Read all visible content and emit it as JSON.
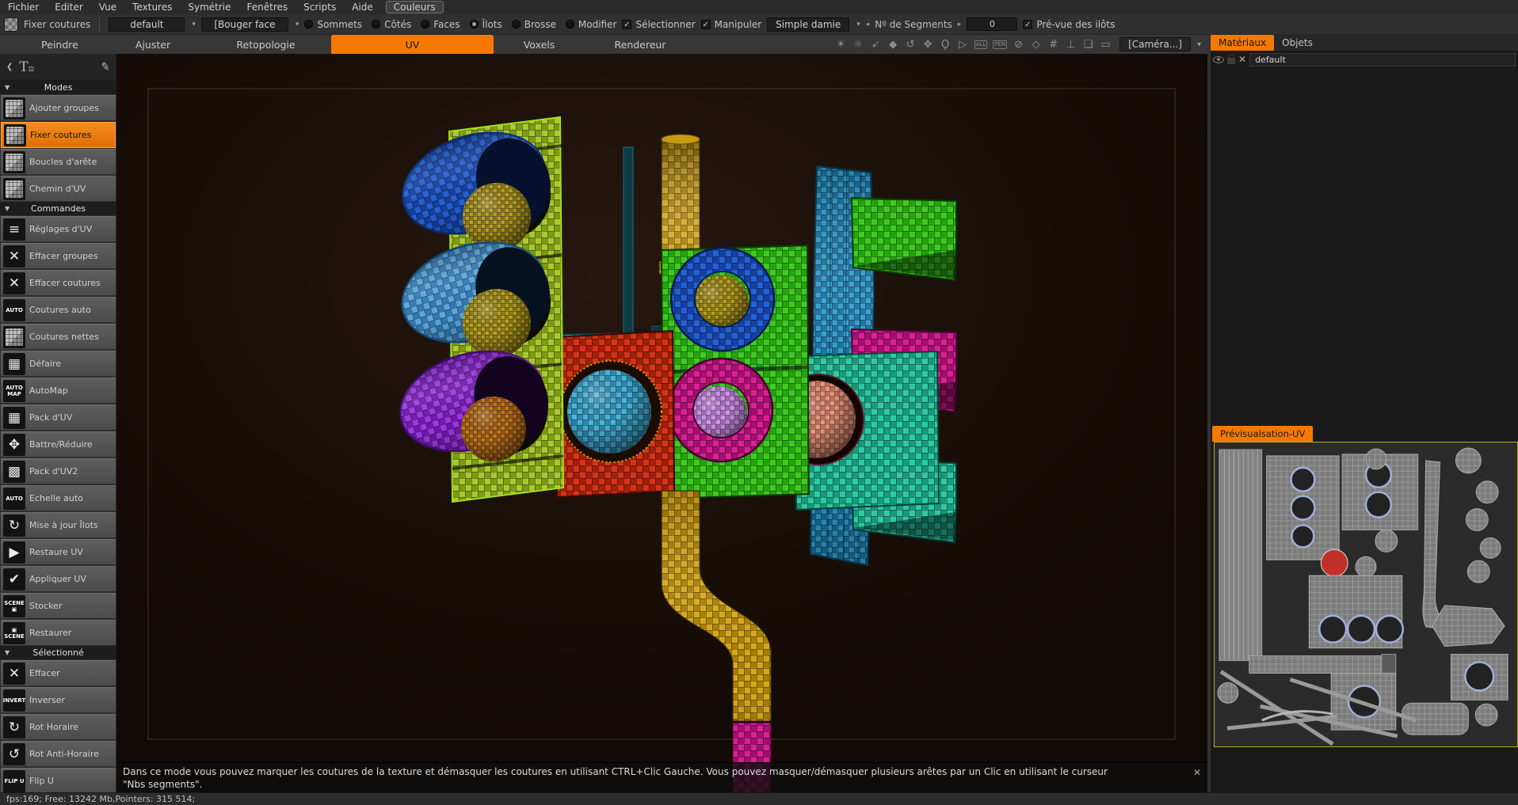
{
  "menu_bar": {
    "items": [
      {
        "label": "Fichier",
        "boxed": false
      },
      {
        "label": "Editer",
        "boxed": false
      },
      {
        "label": "Vue",
        "boxed": false
      },
      {
        "label": "Textures",
        "boxed": false
      },
      {
        "label": "Symétrie",
        "boxed": false
      },
      {
        "label": "Fenêtres",
        "boxed": false
      },
      {
        "label": "Scripts",
        "boxed": false
      },
      {
        "label": "Aide",
        "boxed": false
      },
      {
        "label": "Couleurs",
        "boxed": true
      }
    ]
  },
  "toolbar": {
    "mode_label": "Fixer coutures",
    "preset_value": "default",
    "transform_value": "[Bouger face",
    "radios": [
      {
        "label": "Sommets",
        "selected": false
      },
      {
        "label": "Côtés",
        "selected": false
      },
      {
        "label": "Faces",
        "selected": false
      },
      {
        "label": "Îlots",
        "selected": true
      },
      {
        "label": "Brosse",
        "selected": false
      },
      {
        "label": "Modifier",
        "selected": false
      }
    ],
    "checkboxes": [
      {
        "label": "Sélectionner",
        "checked": true
      },
      {
        "label": "Manipuler",
        "checked": true
      }
    ],
    "pattern_value": "Simple damie",
    "segments_label": "Nº de Segments",
    "segments_value": "0",
    "preview_checkbox": {
      "label": "Pré-vue des ilôts",
      "checked": true
    }
  },
  "tabs": {
    "items": [
      "Peindre",
      "Ajuster",
      "Retopologie",
      "UV",
      "Voxels",
      "Rendereur"
    ],
    "active": "UV"
  },
  "view_toolbar": {
    "icons": [
      {
        "name": "sun-light-icon",
        "glyph": "☀"
      },
      {
        "name": "bulb-light-icon",
        "glyph": "☼"
      },
      {
        "name": "light-direction-icon",
        "glyph": "➶"
      },
      {
        "name": "droplet-icon",
        "glyph": "◆"
      },
      {
        "name": "rotate-view-icon",
        "glyph": "↺"
      },
      {
        "name": "pan-view-icon",
        "glyph": "✥"
      },
      {
        "name": "zoom-view-icon",
        "glyph": "Ϙ"
      },
      {
        "name": "navigate-icon",
        "glyph": "▷"
      },
      {
        "name": "frame-all-icon",
        "glyph": "ALL",
        "small": true
      },
      {
        "name": "frame-pen-icon",
        "glyph": "PEN",
        "small": true
      },
      {
        "name": "disable-icon",
        "glyph": "⊘"
      },
      {
        "name": "wire-cube-icon",
        "glyph": "◇"
      },
      {
        "name": "grid-icon",
        "glyph": "#"
      },
      {
        "name": "axis-icon",
        "glyph": "⊥"
      },
      {
        "name": "maximize-icon",
        "glyph": "❏"
      },
      {
        "name": "backdrop-icon",
        "glyph": "▭"
      }
    ],
    "camera_label": "[Caméra...]",
    "camera_arrow": "▾"
  },
  "sidebar": {
    "sections": [
      {
        "title": "Modes",
        "items": [
          {
            "label": "Ajouter groupes",
            "icon": {
              "kind": "cube"
            },
            "active": false
          },
          {
            "label": "Fixer coutures",
            "icon": {
              "kind": "cube"
            },
            "active": true
          },
          {
            "label": "Boucles d'arête",
            "icon": {
              "kind": "cube"
            },
            "active": false
          },
          {
            "label": "Chemin d'UV",
            "icon": {
              "kind": "cube"
            },
            "active": false
          }
        ]
      },
      {
        "title": "Commandes",
        "items": [
          {
            "label": "Réglages d'UV",
            "icon": {
              "kind": "glyph",
              "value": "≡"
            },
            "active": false
          },
          {
            "label": "Effacer groupes",
            "icon": {
              "kind": "glyph",
              "value": "✕"
            },
            "active": false
          },
          {
            "label": "Effacer coutures",
            "icon": {
              "kind": "glyph",
              "value": "✕"
            },
            "active": false
          },
          {
            "label": "Coutures auto",
            "icon": {
              "kind": "text",
              "value": "AUTO"
            },
            "active": false
          },
          {
            "label": "Coutures nettes",
            "icon": {
              "kind": "cube"
            },
            "active": false
          },
          {
            "label": "Défaire",
            "icon": {
              "kind": "glyph",
              "value": "▦"
            },
            "active": false
          },
          {
            "label": "AutoMap",
            "icon": {
              "kind": "text",
              "value": "AUTO\nMAP"
            },
            "active": false
          },
          {
            "label": "Pack d'UV",
            "icon": {
              "kind": "glyph",
              "value": "▦"
            },
            "active": false
          },
          {
            "label": "Battre/Réduire",
            "icon": {
              "kind": "glyph",
              "value": "✥"
            },
            "active": false
          },
          {
            "label": "Pack d'UV2",
            "icon": {
              "kind": "glyph",
              "value": "▩"
            },
            "active": false
          },
          {
            "label": "Echelle auto",
            "icon": {
              "kind": "text",
              "value": "AUTO"
            },
            "active": false
          },
          {
            "label": "Mise à jour Îlots",
            "icon": {
              "kind": "glyph",
              "value": "↻"
            },
            "active": false
          },
          {
            "label": "Restaure UV",
            "icon": {
              "kind": "glyph",
              "value": "▶"
            },
            "active": false
          },
          {
            "label": "Appliquer UV",
            "icon": {
              "kind": "glyph",
              "value": "✔"
            },
            "active": false
          },
          {
            "label": "Stocker",
            "icon": {
              "kind": "text",
              "value": "SCENE\n▣"
            },
            "active": false
          },
          {
            "label": "Restaurer",
            "icon": {
              "kind": "text",
              "value": "▣\nSCENE"
            },
            "active": false
          }
        ]
      },
      {
        "title": "Sélectionné",
        "items": [
          {
            "label": "Effacer",
            "icon": {
              "kind": "glyph",
              "value": "✕"
            },
            "active": false
          },
          {
            "label": "Inverser",
            "icon": {
              "kind": "text",
              "value": "INVERT"
            },
            "active": false
          },
          {
            "label": "Rot Horaire",
            "icon": {
              "kind": "glyph",
              "value": "↻"
            },
            "active": false
          },
          {
            "label": "Rot Anti-Horaire",
            "icon": {
              "kind": "glyph",
              "value": "↺"
            },
            "active": false
          },
          {
            "label": "Flip U",
            "icon": {
              "kind": "text",
              "value": "FLIP U"
            },
            "active": false
          }
        ]
      }
    ]
  },
  "right_panel": {
    "tabs": [
      {
        "label": "Matériaux",
        "active": true
      },
      {
        "label": "Objets",
        "active": false
      }
    ],
    "material_name": "default",
    "uv_panel_title": "Prévisualsation-UV"
  },
  "status_message": {
    "line1": "Dans ce mode vous pouvez marquer les coutures de la texture et démasquer les coutures en utilisant CTRL+Clic Gauche. Vous pouvez masquer/démasquer plusieurs arêtes par un Clic en utilisant le curseur",
    "line2": "\"Nbs segments\".",
    "close": "✕"
  },
  "status_bar": {
    "text": "fps:169;  Free: 13242 Mb,Pointers: 315 514;"
  },
  "colors": {
    "accent": "#f57900",
    "viewport_bg": "#1c110a",
    "uv_preview_border": "#b9a92c"
  }
}
